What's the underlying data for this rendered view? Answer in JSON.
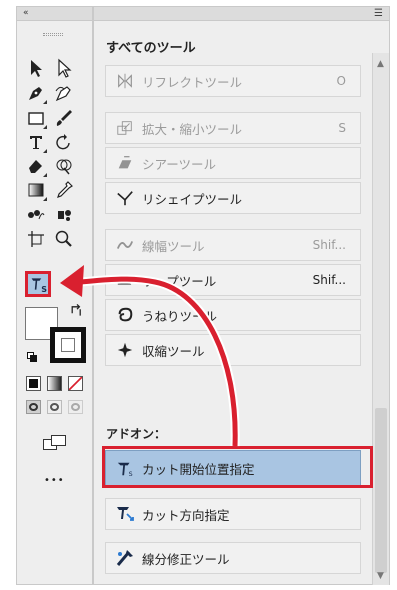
{
  "toolbar": {
    "collapse_label": "«",
    "highlight_label": "S",
    "more_label": "•••"
  },
  "panel": {
    "title": "すべてのツール",
    "menu_icon": "☰",
    "section_label": "アドオン：",
    "items": [
      {
        "label": "リフレクトツール",
        "shortcut": "O",
        "state": "dim"
      },
      {
        "label": "拡大・縮小ツール",
        "shortcut": "S",
        "state": "dim"
      },
      {
        "label": "シアーツール",
        "shortcut": "",
        "state": "dim"
      },
      {
        "label": "リシェイプツール",
        "shortcut": "",
        "state": "normal"
      },
      {
        "label": "線幅ツール",
        "shortcut": "Shif...",
        "state": "dim"
      },
      {
        "label": "ワープツール",
        "shortcut": "Shif...",
        "state": "normal"
      },
      {
        "label": "うねりツール",
        "shortcut": "",
        "state": "normal"
      },
      {
        "label": "収縮ツール",
        "shortcut": "",
        "state": "normal"
      }
    ],
    "addons": [
      {
        "label": "カット開始位置指定",
        "state": "selected"
      },
      {
        "label": "カット方向指定",
        "state": "normal"
      },
      {
        "label": "線分修正ツール",
        "state": "normal"
      }
    ]
  },
  "colors": {
    "callout": "#d9202f",
    "selected_bg": "#a9c5e2",
    "panel_bg": "#eeeeee"
  }
}
